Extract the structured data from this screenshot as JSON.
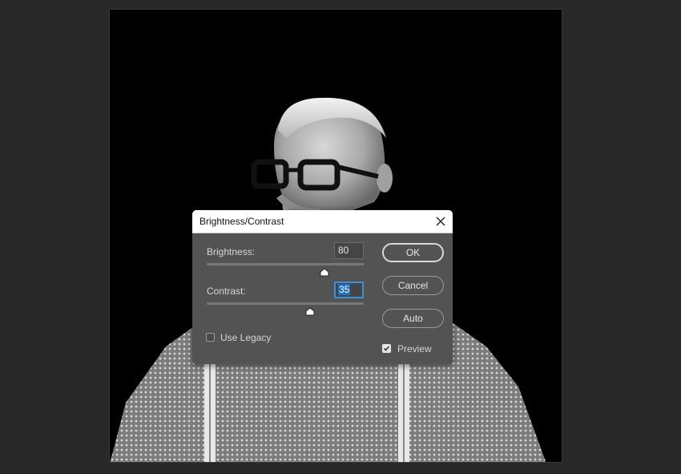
{
  "dialog": {
    "title": "Brightness/Contrast",
    "brightness": {
      "label": "Brightness:",
      "value": "80",
      "level": 0.75
    },
    "contrast": {
      "label": "Contrast:",
      "value": "35",
      "level": 0.66
    },
    "use_legacy": {
      "label": "Use Legacy",
      "checked": false
    },
    "preview": {
      "label": "Preview",
      "checked": true
    },
    "buttons": {
      "ok": "OK",
      "cancel": "Cancel",
      "auto": "Auto"
    }
  },
  "icons": {
    "close": "close-icon",
    "check": "check-icon",
    "thumb": "slider-thumb-icon"
  },
  "colors": {
    "accent": "#3d8fd8",
    "dialog_bg": "#535353",
    "app_bg": "#282828"
  }
}
